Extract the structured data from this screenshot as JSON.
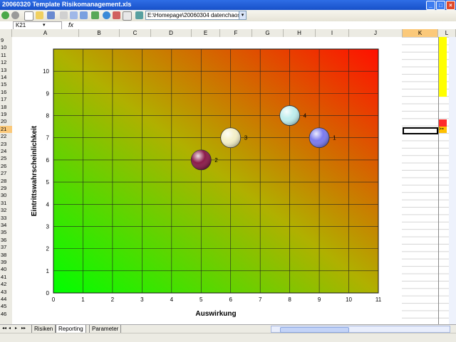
{
  "window": {
    "title": "20060320 Template Risikomanagement.xls",
    "minimize": "_",
    "maximize": "□",
    "close": "×"
  },
  "toolbar": {
    "address_value": "E:\\Homepage\\20060304 datenchaos\\do",
    "address_dropdown": "▾",
    "icons": [
      "back-icon",
      "forward-icon",
      "new-icon",
      "open-icon",
      "save-icon",
      "print-icon",
      "copy-icon",
      "paste-icon",
      "sheet-icon",
      "globe-icon",
      "find-icon",
      "zoom-icon",
      "link-icon"
    ]
  },
  "formula_bar": {
    "name_box": "K21",
    "name_dropdown": "▾",
    "fx": "fx"
  },
  "columns": [
    "A",
    "B",
    "C",
    "D",
    "E",
    "F",
    "G",
    "H",
    "I",
    "J",
    "K",
    "L"
  ],
  "rows": [
    "9",
    "10",
    "11",
    "12",
    "13",
    "14",
    "15",
    "16",
    "17",
    "18",
    "19",
    "20",
    "21",
    "22",
    "23",
    "24",
    "25",
    "26",
    "27",
    "28",
    "29",
    "30",
    "31",
    "32",
    "33",
    "34",
    "35",
    "36",
    "37",
    "38",
    "39",
    "40",
    "41",
    "42",
    "43",
    "44",
    "45",
    "46"
  ],
  "selected_row": "21",
  "selected_column": "K",
  "side_cell_text": ">=",
  "sheet_tabs": {
    "nav": [
      "◂◂",
      "◂",
      "▸",
      "▸▸"
    ],
    "tabs": [
      "Risiken",
      "Reporting",
      "Parameter"
    ],
    "active": "Reporting"
  },
  "chart_data": {
    "type": "scatter",
    "title": "",
    "xlabel": "Auswirkung",
    "ylabel": "Eintrittswahrscheinlichkeit",
    "xlim": [
      0,
      11
    ],
    "ylim": [
      0,
      11
    ],
    "xticks": [
      "0",
      "1",
      "2",
      "3",
      "4",
      "5",
      "6",
      "7",
      "8",
      "9",
      "10",
      "11"
    ],
    "yticks": [
      "0",
      "1",
      "2",
      "3",
      "4",
      "5",
      "6",
      "7",
      "8",
      "9",
      "10"
    ],
    "grid": true,
    "background": "gradient green (bottom-left) to red (top-right)",
    "points": [
      {
        "label": "1",
        "x": 9,
        "y": 7,
        "color": "#7b7bf0"
      },
      {
        "label": "2",
        "x": 5,
        "y": 6,
        "color": "#8b1c4a"
      },
      {
        "label": "3",
        "x": 6,
        "y": 7,
        "color": "#f4f0c8"
      },
      {
        "label": "4",
        "x": 8,
        "y": 8,
        "color": "#bfeeee"
      }
    ]
  }
}
